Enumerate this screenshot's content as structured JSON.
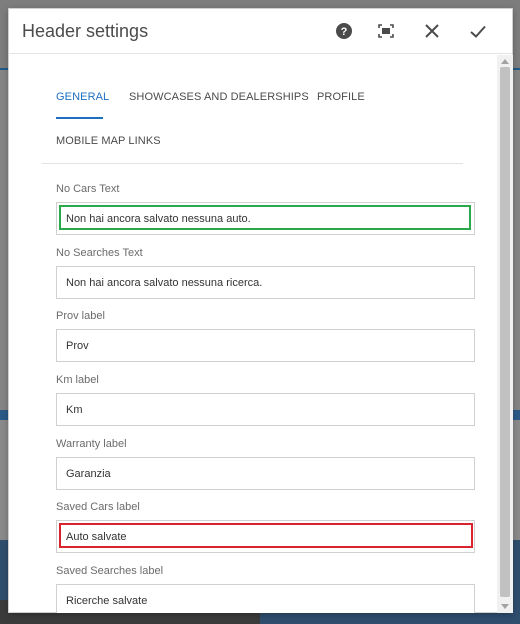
{
  "dialog": {
    "title": "Header settings",
    "icons": {
      "help": "help-circle-icon",
      "fullscreen": "fullscreen-icon",
      "close": "close-icon",
      "confirm": "checkmark-icon"
    }
  },
  "tabs": [
    {
      "label": "GENERAL",
      "active": true
    },
    {
      "label": "SHOWCASES AND DEALERSHIPS",
      "active": false
    },
    {
      "label": "PROFILE",
      "active": false
    },
    {
      "label": "MOBILE MAP LINKS",
      "active": false
    }
  ],
  "fields": [
    {
      "label": "No Cars Text",
      "value": "Non hai ancora salvato nessuna auto.",
      "highlight": "green"
    },
    {
      "label": "No Searches Text",
      "value": "Non hai ancora salvato nessuna ricerca."
    },
    {
      "label": "Prov label",
      "value": "Prov"
    },
    {
      "label": "Km label",
      "value": "Km"
    },
    {
      "label": "Warranty label",
      "value": "Garanzia"
    },
    {
      "label": "Saved Cars label",
      "value": "Auto salvate",
      "highlight": "red"
    },
    {
      "label": "Saved Searches label",
      "value": "Ricerche salvate"
    }
  ],
  "colors": {
    "accent": "#1f6fc0",
    "highlight_green": "#2ba84a",
    "highlight_red": "#d9232d"
  }
}
